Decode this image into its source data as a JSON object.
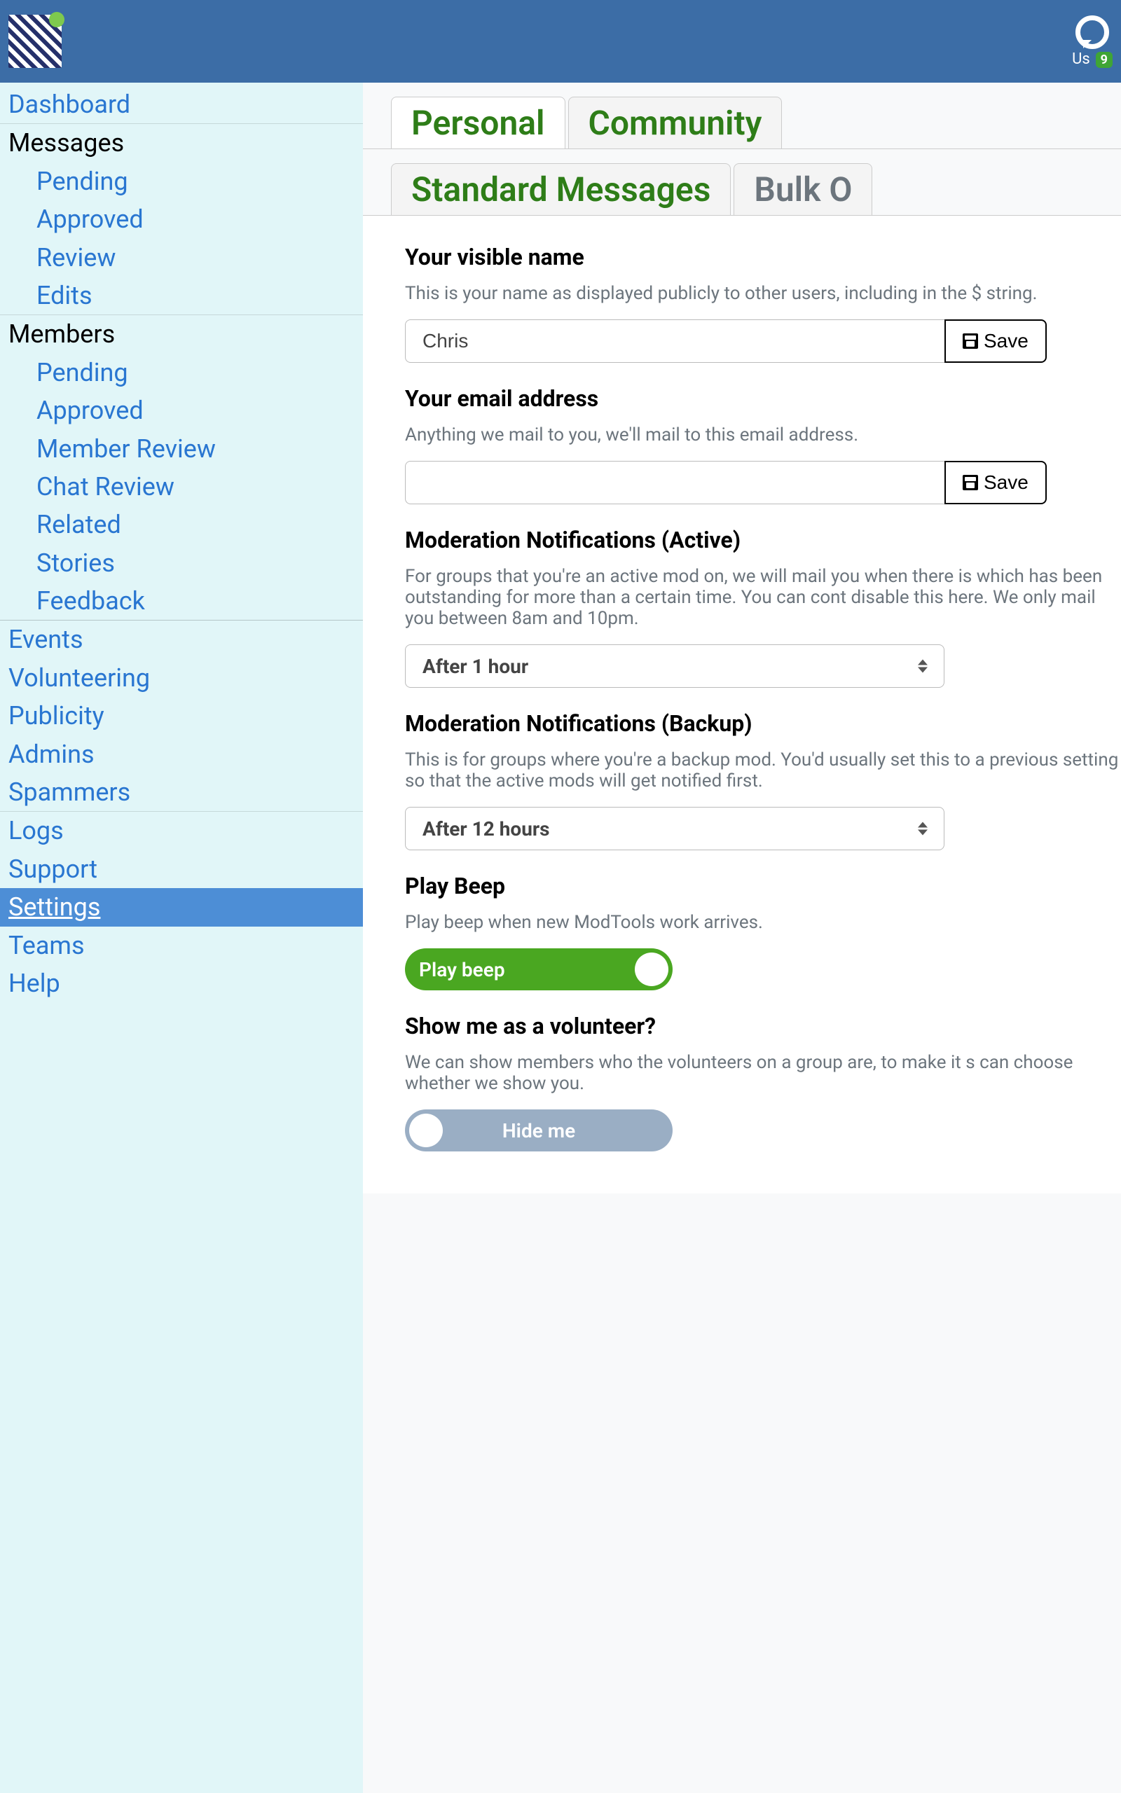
{
  "header": {
    "us_label": "Us",
    "us_count": "9"
  },
  "sidebar": {
    "dashboard": "Dashboard",
    "messages_label": "Messages",
    "messages": {
      "pending": "Pending",
      "approved": "Approved",
      "review": "Review",
      "edits": "Edits"
    },
    "members_label": "Members",
    "members": {
      "pending": "Pending",
      "approved": "Approved",
      "member_review": "Member Review",
      "chat_review": "Chat Review",
      "related": "Related",
      "stories": "Stories",
      "feedback": "Feedback"
    },
    "events": "Events",
    "volunteering": "Volunteering",
    "publicity": "Publicity",
    "admins": "Admins",
    "spammers": "Spammers",
    "logs": "Logs",
    "support": "Support",
    "settings": "Settings",
    "teams": "Teams",
    "help": "Help"
  },
  "tabs": {
    "personal": "Personal",
    "community": "Community",
    "standard": "Standard Messages",
    "bulk": "Bulk O"
  },
  "name_section": {
    "title": "Your visible name",
    "desc": "This is your name as displayed publicly to other users, including in the $ string.",
    "value": "Chris",
    "save": "Save"
  },
  "email_section": {
    "title": "Your email address",
    "desc": "Anything we mail to you, we'll mail to this email address.",
    "value": "",
    "save": "Save"
  },
  "mod_active": {
    "title": "Moderation Notifications (Active)",
    "desc": "For groups that you're an active mod on, we will mail you when there is which has been outstanding for more than a certain time. You can cont disable this here. We only mail you between 8am and 10pm.",
    "value": "After 1 hour"
  },
  "mod_backup": {
    "title": "Moderation Notifications (Backup)",
    "desc": "This is for groups where you're a backup mod. You'd usually set this to a previous setting so that the active mods will get notified first.",
    "value": "After 12 hours"
  },
  "beep": {
    "title": "Play Beep",
    "desc": "Play beep when new ModTools work arrives.",
    "toggle": "Play beep"
  },
  "volunteer": {
    "title": "Show me as a volunteer?",
    "desc": "We can show members who the volunteers on a group are, to make it s can choose whether we show you.",
    "toggle": "Hide me"
  }
}
